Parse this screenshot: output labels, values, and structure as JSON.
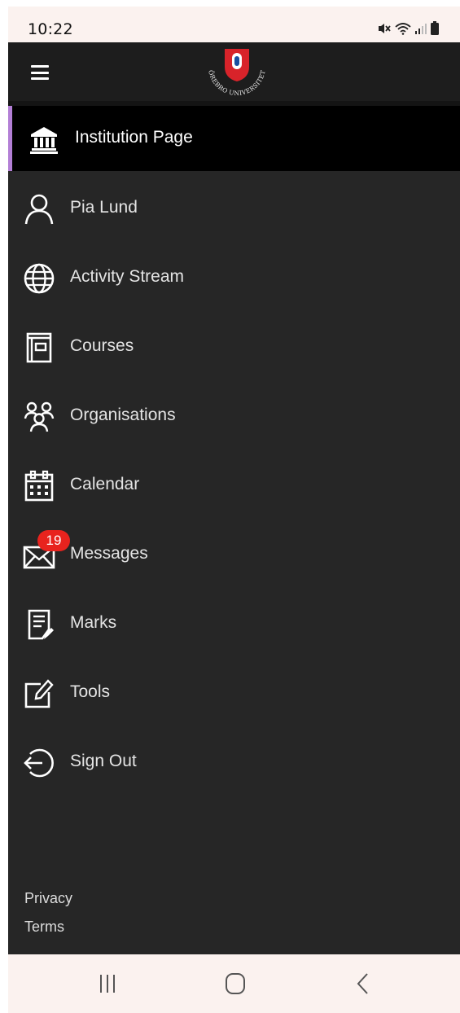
{
  "status_bar": {
    "time": "10:22",
    "icons": [
      "mute-icon",
      "wifi-icon",
      "signal-icon",
      "battery-icon"
    ]
  },
  "header": {
    "menu_icon": "hamburger-icon",
    "logo_text": "ÖREBRO UNIVERSITET"
  },
  "menu": {
    "active_accent_color": "#b37fd6",
    "items": [
      {
        "label": "Institution Page",
        "icon": "institution-icon",
        "active": true
      },
      {
        "label": "Pia Lund",
        "icon": "person-icon"
      },
      {
        "label": "Activity Stream",
        "icon": "globe-icon"
      },
      {
        "label": "Courses",
        "icon": "course-book-icon"
      },
      {
        "label": "Organisations",
        "icon": "people-group-icon"
      },
      {
        "label": "Calendar",
        "icon": "calendar-icon"
      },
      {
        "label": "Messages",
        "icon": "envelope-icon",
        "badge": "19"
      },
      {
        "label": "Marks",
        "icon": "grades-document-icon"
      },
      {
        "label": "Tools",
        "icon": "edit-tools-icon"
      },
      {
        "label": "Sign Out",
        "icon": "sign-out-icon"
      }
    ]
  },
  "footer": {
    "privacy": "Privacy",
    "terms": "Terms"
  },
  "system_nav": {
    "buttons": [
      "recent-apps-icon",
      "home-icon",
      "back-icon"
    ]
  },
  "colors": {
    "drawer_background": "#262626",
    "header_background": "#1d1d1d",
    "badge": "#e8231e"
  }
}
